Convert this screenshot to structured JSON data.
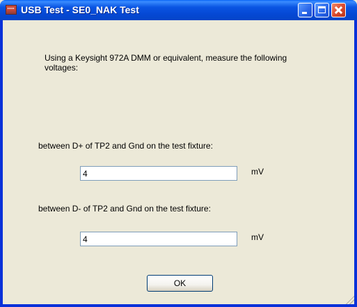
{
  "window": {
    "title": "USB Test - SE0_NAK Test"
  },
  "dialog": {
    "instructions": "Using a Keysight  972A DMM or equivalent, measure the following voltages:",
    "dplus_label": "between D+ of TP2 and Gnd on the test fixture:",
    "dplus_value": "4",
    "dplus_unit": "mV",
    "dminus_label": "between D- of TP2 and Gnd on the test fixture:",
    "dminus_value": "4",
    "dminus_unit": "mV",
    "ok_label": "OK"
  },
  "colors": {
    "titlebar": "#0548d4",
    "dialog_bg": "#ece9d8",
    "close_button": "#d9482c"
  },
  "icons": [
    "app-icon",
    "minimize-icon",
    "maximize-icon",
    "close-icon",
    "resize-grip-icon"
  ]
}
